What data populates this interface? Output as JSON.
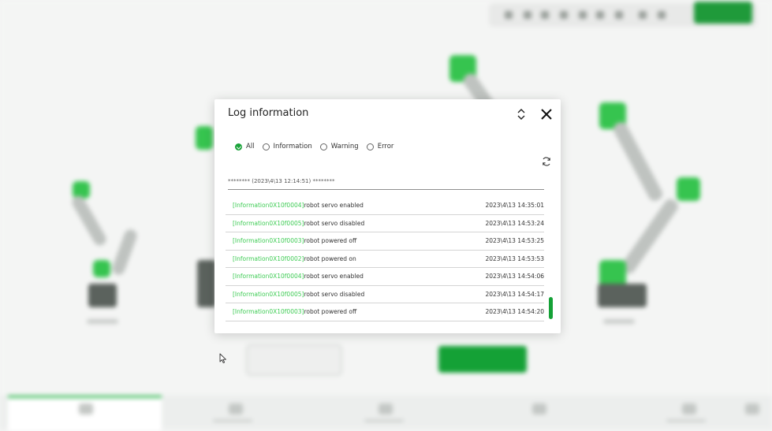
{
  "dialog": {
    "title": "Log information",
    "filters": [
      {
        "label": "All",
        "checked": true
      },
      {
        "label": "Information",
        "checked": false
      },
      {
        "label": "Warning",
        "checked": false
      },
      {
        "label": "Error",
        "checked": false
      }
    ],
    "session_line": "******** (2023\\4\\13 12:14:51) ********",
    "logs": [
      {
        "code": "[Information0X10f0004]",
        "message": "robot servo enabled",
        "time": "2023\\4\\13 14:35:01"
      },
      {
        "code": "[Information0X10f0005]",
        "message": "robot servo disabled",
        "time": "2023\\4\\13 14:53:24"
      },
      {
        "code": "[Information0X10f0003]",
        "message": "robot powered off",
        "time": "2023\\4\\13 14:53:25"
      },
      {
        "code": "[Information0X10f0002]",
        "message": "robot powered on",
        "time": "2023\\4\\13 14:53:53"
      },
      {
        "code": "[Information0X10f0004]",
        "message": "robot servo enabled",
        "time": "2023\\4\\13 14:54:06"
      },
      {
        "code": "[Information0X10f0005]",
        "message": "robot servo disabled",
        "time": "2023\\4\\13 14:54:17"
      },
      {
        "code": "[Information0X10f0003]",
        "message": "robot powered off",
        "time": "2023\\4\\13 14:54:20"
      }
    ]
  },
  "colors": {
    "accent": "#14a136",
    "log_code": "#3fcc55"
  },
  "icons": {
    "expand": "chevron-up-down-icon",
    "close": "close-icon",
    "refresh": "refresh-icon"
  }
}
